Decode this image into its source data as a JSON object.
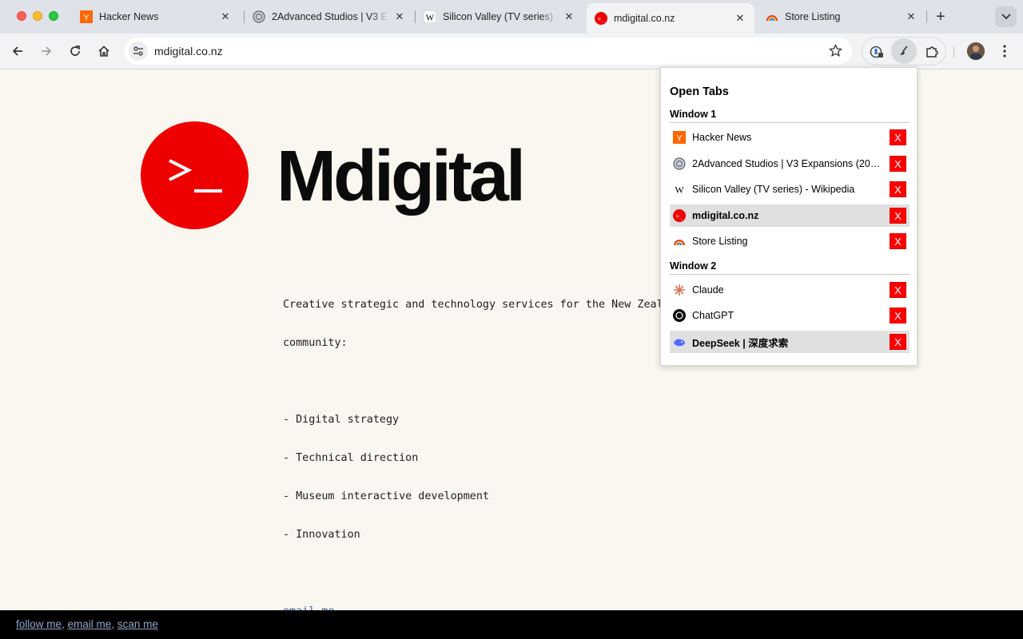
{
  "browser": {
    "tabs": [
      {
        "title": "Hacker News",
        "icon": "y-combinator-icon",
        "active": false
      },
      {
        "title": "2Advanced Studios | V3 E",
        "icon": "2advanced-icon",
        "active": false
      },
      {
        "title": "Silicon Valley (TV series)",
        "icon": "wikipedia-icon",
        "active": false
      },
      {
        "title": "mdigital.co.nz",
        "icon": "mdigital-icon",
        "active": true
      },
      {
        "title": "Store Listing",
        "icon": "rainbow-icon",
        "active": false
      }
    ],
    "new_tab_label": "+",
    "url": "mdigital.co.nz"
  },
  "page": {
    "logo_prompt": ">_",
    "logo_text": "Mdigital",
    "intro_line1": "Creative strategic and technology services for the New Zealand",
    "intro_line2": "community:",
    "services": [
      "- Digital strategy",
      "- Technical direction",
      "- Museum interactive development",
      "- Innovation"
    ],
    "email_link": "email me",
    "footer": {
      "links": [
        "follow me",
        "email me",
        "scan me"
      ],
      "separator": ", "
    }
  },
  "popup": {
    "title": "Open Tabs",
    "close_label": "X",
    "windows": [
      {
        "label": "Window 1",
        "tabs": [
          {
            "title": "Hacker News",
            "icon": "y-combinator-icon",
            "highlighted": false
          },
          {
            "title": "2Advanced Studios | V3 Expansions (2024...",
            "icon": "2advanced-icon",
            "highlighted": false
          },
          {
            "title": "Silicon Valley (TV series) - Wikipedia",
            "icon": "wikipedia-icon",
            "highlighted": false
          },
          {
            "title": "mdigital.co.nz",
            "icon": "mdigital-icon",
            "highlighted": true
          },
          {
            "title": "Store Listing",
            "icon": "rainbow-icon",
            "highlighted": false
          }
        ]
      },
      {
        "label": "Window 2",
        "tabs": [
          {
            "title": "Claude",
            "icon": "claude-icon",
            "highlighted": false
          },
          {
            "title": "ChatGPT",
            "icon": "chatgpt-icon",
            "highlighted": false
          },
          {
            "title": "DeepSeek | 深度求索",
            "icon": "deepseek-icon",
            "highlighted": true
          }
        ]
      }
    ]
  },
  "colors": {
    "brand_red": "#ee0000",
    "page_bg": "#faf7f0",
    "close_button": "#ff0000",
    "link": "#3f5ea8"
  }
}
